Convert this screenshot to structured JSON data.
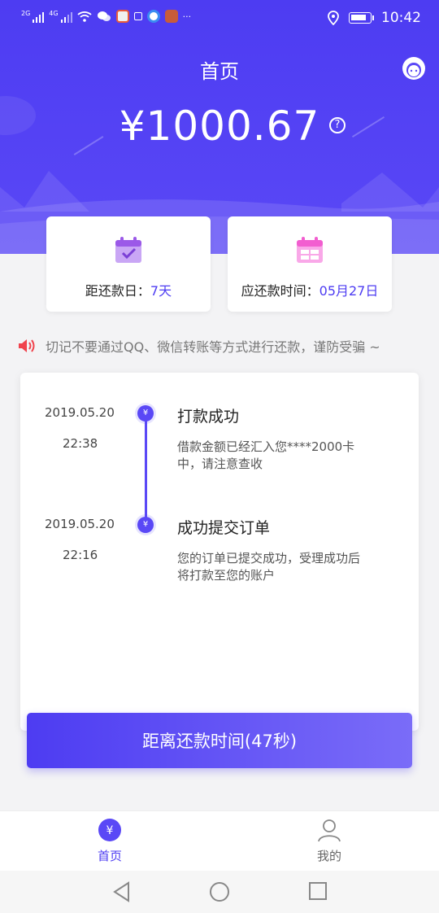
{
  "status_bar": {
    "signal1_label": "2G",
    "signal2_label": "4G",
    "more": "···",
    "time": "10:42"
  },
  "header": {
    "title": "首页",
    "amount": "¥1000.67",
    "help_symbol": "?"
  },
  "cards": [
    {
      "label": "距还款日：",
      "value": "7天",
      "icon": "calendar-check-icon"
    },
    {
      "label": "应还款时间：",
      "value": "05月27日",
      "icon": "calendar-grid-icon"
    }
  ],
  "notice": {
    "text": "切记不要通过QQ、微信转账等方式进行还款，谨防受骗 ~",
    "icon": "speaker-icon"
  },
  "timeline": [
    {
      "date": "2019.05.20",
      "time": "22:38",
      "marker": "¥",
      "title": "打款成功",
      "desc": "借款金额已经汇入您****2000卡中，请注意查收"
    },
    {
      "date": "2019.05.20",
      "time": "22:16",
      "marker": "¥",
      "title": "成功提交订单",
      "desc": "您的订单已提交成功，受理成功后将打款至您的账户"
    }
  ],
  "action_button": "距离还款时间(47秒)",
  "bottom_nav": {
    "home_label": "首页",
    "home_icon_symbol": "¥",
    "me_label": "我的"
  },
  "colors": {
    "primary": "#4d3cf2",
    "card_icon_purple": "#9b59e8",
    "card_icon_pink": "#f25ed0",
    "notice_red": "#f0434d"
  }
}
